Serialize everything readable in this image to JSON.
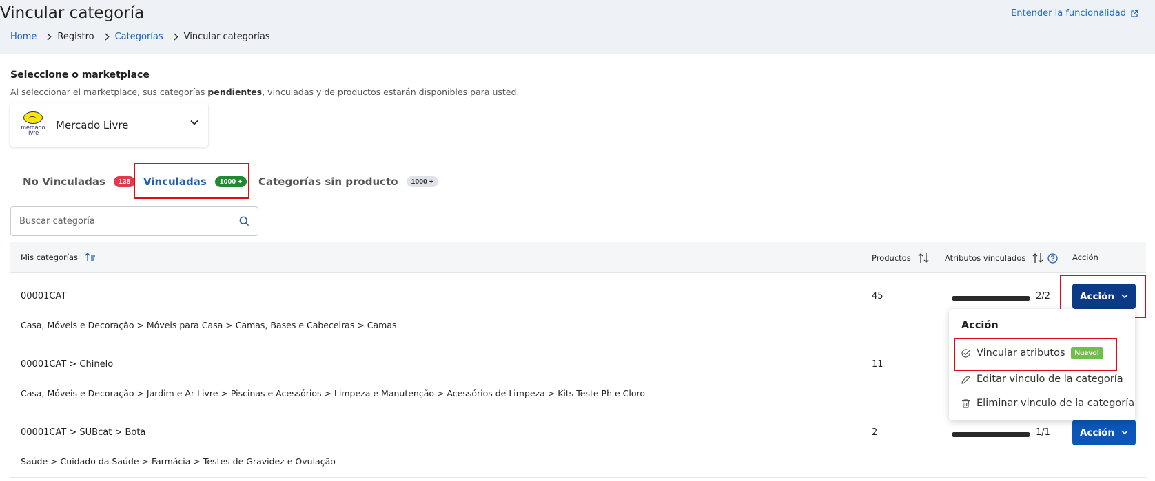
{
  "page": {
    "title": "Vincular categoría",
    "help_link": "Entender la funcionalidad"
  },
  "breadcrumb": {
    "items": [
      "Home",
      "Registro",
      "Categorías",
      "Vincular categorías"
    ]
  },
  "marketplace": {
    "title": "Seleccione o marketplace",
    "subtitle_before": "Al seleccionar el marketplace, sus categorías ",
    "subtitle_bold": "pendientes",
    "subtitle_after": ", vinculadas y de productos estarán disponibles para usted.",
    "logo_text_line1": "mercado",
    "logo_text_line2": "livre",
    "selected": "Mercado Livre"
  },
  "tabs": [
    {
      "label": "No Vinculadas",
      "count": "138",
      "badge_color": "#e03a4b"
    },
    {
      "label": "Vinculadas",
      "count": "1000 +",
      "badge_color": "#1f8a2f",
      "active": true
    },
    {
      "label": "Categorías sin producto",
      "count": "1000 +",
      "badge_color": "#dfe2e6"
    }
  ],
  "search": {
    "placeholder": "Buscar categoría"
  },
  "table": {
    "headers": {
      "categories": "Mis categorías",
      "products": "Productos",
      "attributes": "Atributos vinculados",
      "action": "Acción"
    },
    "rows": [
      {
        "name": "00001CAT",
        "path": "Casa, Móveis e Decoração > Móveis para Casa > Camas, Bases e Cabeceiras > Camas",
        "products": "45",
        "attributes_text": "2/2",
        "attributes_fraction": 1.0,
        "action_label": "Acción"
      },
      {
        "name": "00001CAT > Chinelo",
        "path": "Casa, Móveis e Decoração > Jardim e Ar Livre > Piscinas e Acessórios > Limpeza e Manutenção > Acessórios de Limpeza > Kits Teste Ph e Cloro",
        "products": "11"
      },
      {
        "name": "00001CAT > SUBcat > Bota",
        "path": "Saúde > Cuidado da Saúde > Farmácia > Testes de Gravidez e Ovulação",
        "products": "2",
        "attributes_text": "1/1",
        "attributes_fraction": 1.0,
        "action_label": "Acción"
      }
    ]
  },
  "dropdown": {
    "title": "Acción",
    "items": [
      {
        "label": "Vincular atributos",
        "icon": "check-circle-icon",
        "badge": "Nuevo!"
      },
      {
        "label": "Editar vinculo de la categoría",
        "icon": "pencil-icon"
      },
      {
        "label": "Eliminar vinculo de la categoría",
        "icon": "trash-icon"
      }
    ]
  },
  "colors": {
    "primary": "#0b56b8",
    "primary_dark": "#0c3a86",
    "link": "#1f5fb0",
    "highlight": "#e10b17",
    "new_badge": "#6fbf4a"
  }
}
